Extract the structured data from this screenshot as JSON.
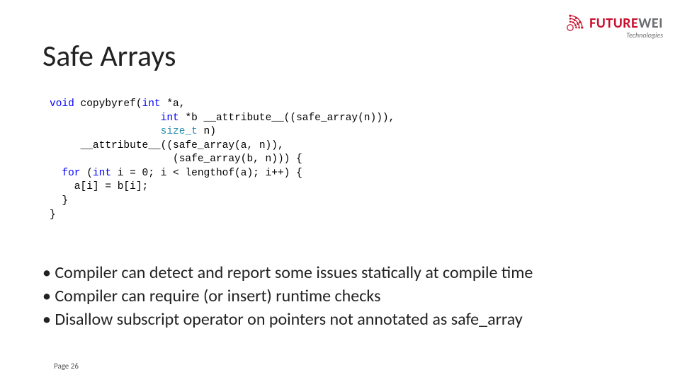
{
  "logo": {
    "main_red": "FUTURE",
    "main_gray": "WEI",
    "sub": "Technologies"
  },
  "title": "Safe Arrays",
  "code": {
    "l1a": "void",
    "l1b": " copybyref(",
    "l1c": "int",
    "l1d": " *a,",
    "l2a": "                  ",
    "l2b": "int",
    "l2c": " *b __attribute__((safe_array(n))),",
    "l3a": "                  ",
    "l3b": "size_t",
    "l3c": " n)",
    "l4": "     __attribute__((safe_array(a, n)),",
    "l5": "                    (safe_array(b, n))) {",
    "l6a": "  ",
    "l6b": "for",
    "l6c": " (",
    "l6d": "int",
    "l6e": " i = 0; i < lengthof(a); i++) {",
    "l7": "    a[i] = b[i];",
    "l8": "  }",
    "l9": "}"
  },
  "bullets": {
    "b1": "• Compiler can detect and report some issues statically at compile time",
    "b2": "• Compiler can require (or insert) runtime checks",
    "b3": "• Disallow subscript operator on pointers not annotated as safe_array"
  },
  "page": "Page 26"
}
